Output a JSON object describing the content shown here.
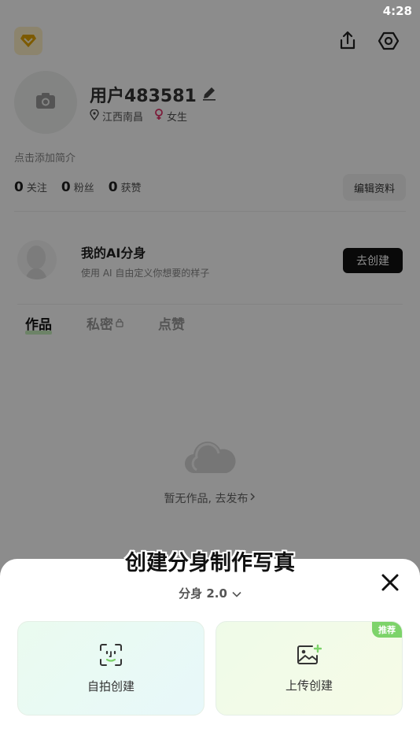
{
  "status_bar": {
    "time": "4:28"
  },
  "profile": {
    "username": "用户483581",
    "location": "江西南昌",
    "gender": "女生",
    "bio_placeholder": "点击添加简介",
    "stats": [
      {
        "value": "0",
        "label": "关注"
      },
      {
        "value": "0",
        "label": "粉丝"
      },
      {
        "value": "0",
        "label": "获赞"
      }
    ],
    "edit_button": "编辑资料"
  },
  "ai_clone": {
    "title": "我的AI分身",
    "subtitle": "使用 AI 自由定义你想要的样子",
    "button": "去创建"
  },
  "tabs": [
    {
      "label": "作品",
      "active": true
    },
    {
      "label": "私密",
      "active": false,
      "locked": true
    },
    {
      "label": "点赞",
      "active": false
    }
  ],
  "empty_state": {
    "text": "暂无作品, 去发布"
  },
  "sheet": {
    "title": "创建分身制作写真",
    "version": "分身 2.0",
    "options": [
      {
        "label": "自拍创建",
        "icon": "face-scan-icon"
      },
      {
        "label": "上传创建",
        "icon": "image-add-icon",
        "badge": "推荐"
      }
    ]
  },
  "colors": {
    "accent_green": "#7dd36a",
    "create_button_bg": "#111111",
    "gender_icon": "#e2336b"
  }
}
